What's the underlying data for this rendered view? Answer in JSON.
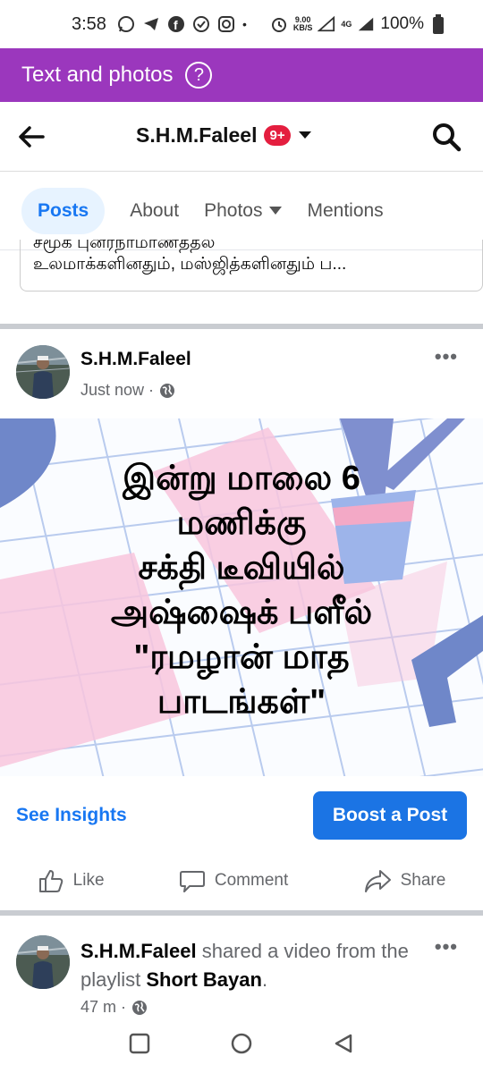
{
  "status_bar": {
    "time": "3:58",
    "speed_top": "9.00",
    "speed_bottom": "KB/S",
    "network": "4G",
    "battery": "100%"
  },
  "banner": {
    "label": "Text and photos",
    "help_symbol": "?"
  },
  "header": {
    "title": "S.H.M.Faleel",
    "badge": "9+"
  },
  "tabs": [
    {
      "label": "Posts",
      "active": true
    },
    {
      "label": "About"
    },
    {
      "label": "Photos"
    },
    {
      "label": "Mentions"
    }
  ],
  "previous_post": {
    "line1": "சமூக புனரநாமாணததல",
    "line2": "உலமாக்களினதும், மஸ்ஜித்களினதும் ப..."
  },
  "post": {
    "author": "S.H.M.Faleel",
    "time": "Just now ·",
    "caption": "இன்று மாலை 6\nமணிக்கு\nசக்தி டீவியில்\nஅஷ்ஷைக் பளீல்\n\"ரமழான் மாத\nபாடங்கள்\"",
    "more": "•••",
    "see_insights": "See Insights",
    "boost": "Boost a Post",
    "like": "Like",
    "comment": "Comment",
    "share": "Share"
  },
  "post2": {
    "author": "S.H.M.Faleel",
    "shared_text": " shared a video from the playlist ",
    "playlist": "Short Bayan",
    "dot": ".",
    "time": "47 m ·",
    "more": "•••"
  },
  "colors": {
    "banner": "#9b37bd",
    "accent": "#1877f2",
    "boost": "#1b74e4",
    "badge": "#e41e3f"
  },
  "icons": [
    "whatsapp-icon",
    "telegram-icon",
    "facebook-icon",
    "check-icon",
    "instagram-icon",
    "alarm-icon",
    "signal-icon",
    "battery-icon",
    "back-arrow-icon",
    "search-icon",
    "globe-icon",
    "like-icon",
    "comment-icon",
    "share-icon",
    "recents-icon",
    "home-icon",
    "back-nav-icon"
  ]
}
